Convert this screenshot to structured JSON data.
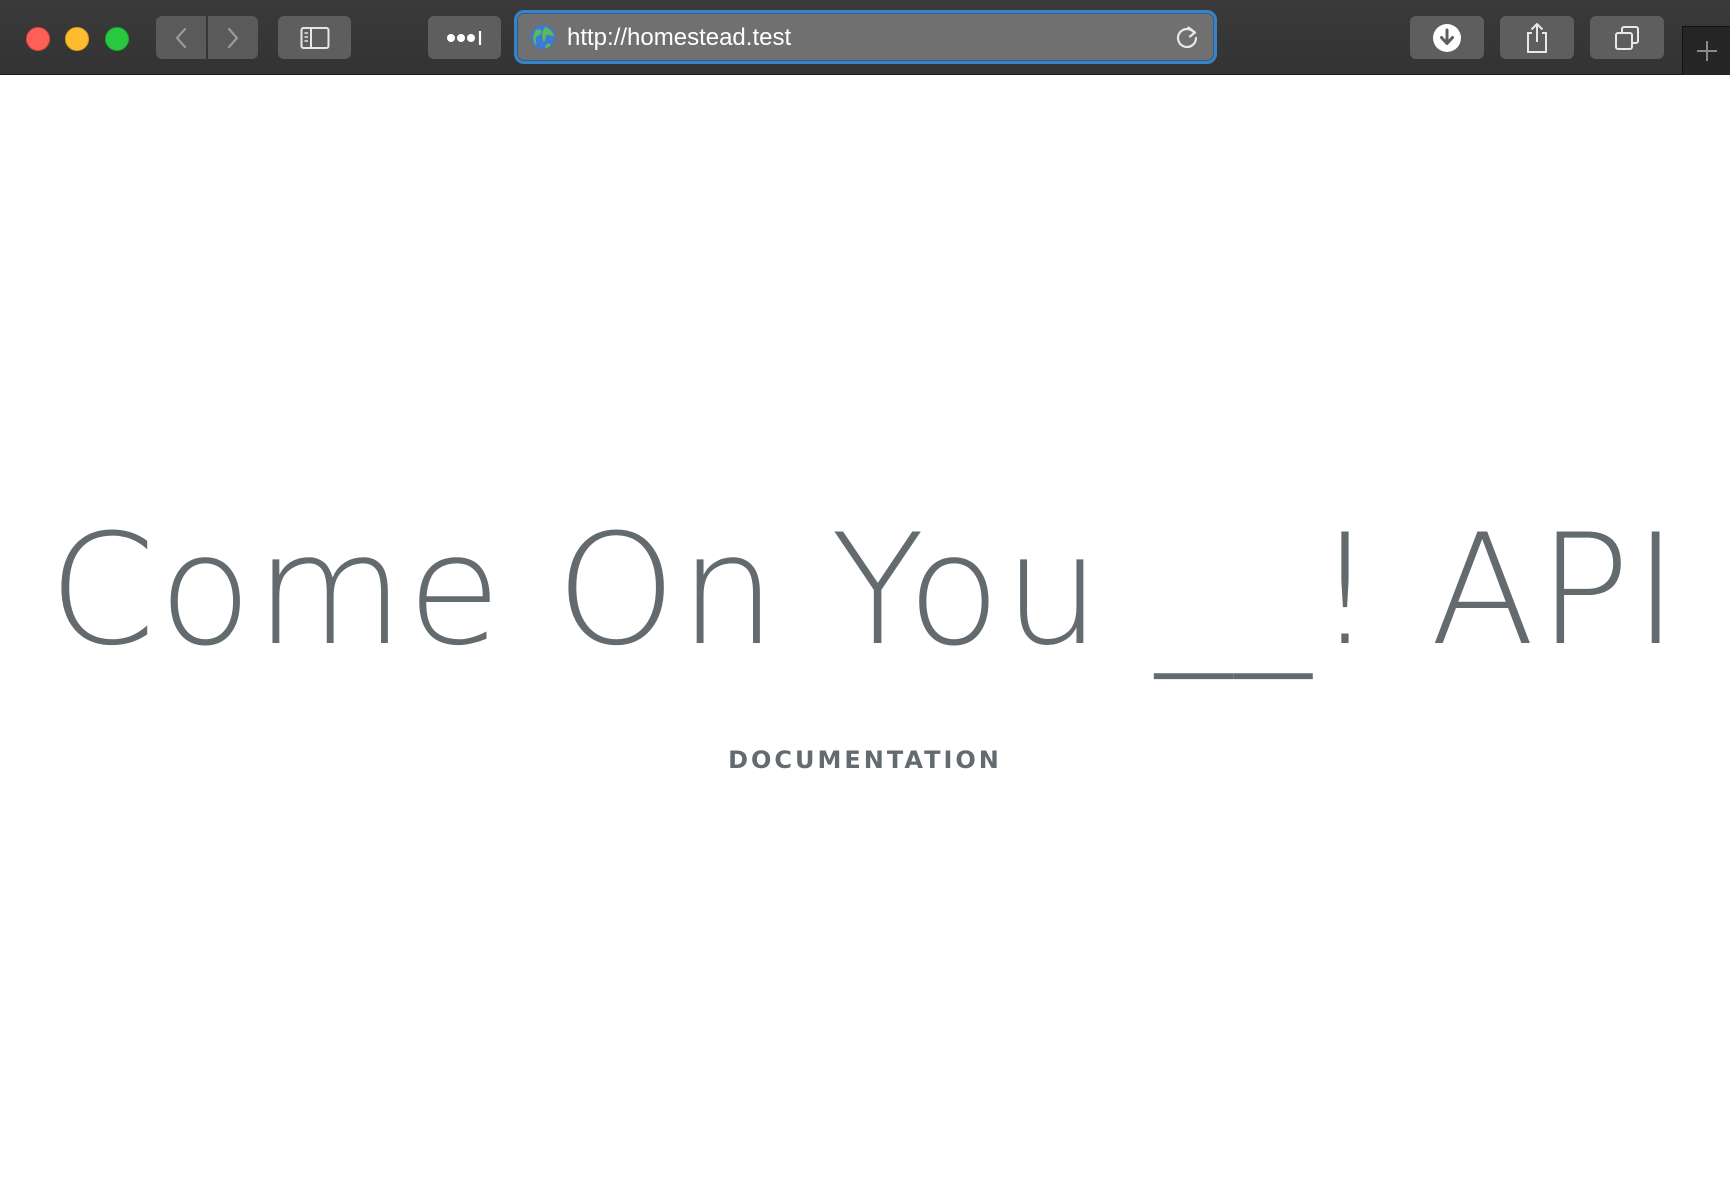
{
  "browser": {
    "address_bar": {
      "url": "http://homestead.test"
    },
    "toolbar": {
      "back_icon": "chevron-left-icon",
      "forward_icon": "chevron-right-icon",
      "sidebar_icon": "sidebar-icon",
      "extensions_icon": "more-dots-icon",
      "download_icon": "download-icon",
      "share_icon": "share-icon",
      "tabs_icon": "tab-overview-icon",
      "new_tab_icon": "plus-icon"
    },
    "colors": {
      "toolbar": "#383838",
      "address_focus": "#3b82c4",
      "close": "#fe5f57",
      "minimize": "#febc2e",
      "zoom": "#28c840"
    }
  },
  "page": {
    "title": "Come On You __! API",
    "links": [
      {
        "label": "DOCUMENTATION"
      }
    ],
    "text_color": "#636b6f"
  }
}
